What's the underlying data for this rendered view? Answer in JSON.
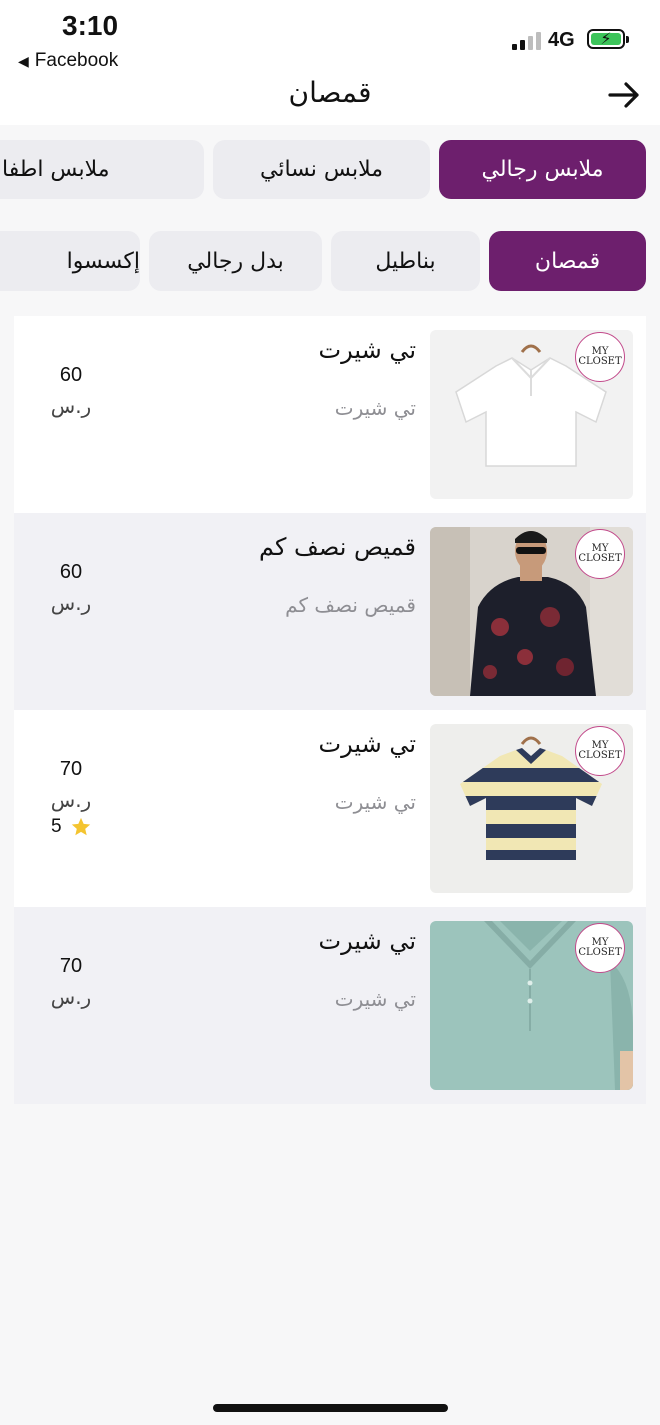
{
  "status": {
    "time": "3:10",
    "back_app": "Facebook",
    "network": "4G"
  },
  "header": {
    "title": "قمصان"
  },
  "category_tabs": [
    {
      "label": "ملابس رجالي",
      "active": true
    },
    {
      "label": "ملابس نسائي",
      "active": false
    },
    {
      "label": "ملابس اطفال",
      "active": false
    }
  ],
  "subcategory_tabs": [
    {
      "label": "قمصان",
      "active": true
    },
    {
      "label": "بناطيل",
      "active": false
    },
    {
      "label": "بدل رجالي",
      "active": false
    },
    {
      "label": "إكسسوا",
      "active": false
    }
  ],
  "brand": {
    "logo_text": [
      "MY",
      "CLOSET"
    ]
  },
  "products": [
    {
      "title": "تي شيرت",
      "subtitle": "تي شيرت",
      "price": "60",
      "currency": "ر.س",
      "rating": null,
      "image": "white-polo"
    },
    {
      "title": "قميص نصف كم",
      "subtitle": "قميص نصف كم",
      "price": "60",
      "currency": "ر.س",
      "rating": null,
      "image": "floral-shirt-model"
    },
    {
      "title": "تي شيرت",
      "subtitle": "تي شيرت",
      "price": "70",
      "currency": "ر.س",
      "rating": "5",
      "image": "striped-polo"
    },
    {
      "title": "تي شيرت",
      "subtitle": "تي شيرت",
      "price": "70",
      "currency": "ر.س",
      "rating": null,
      "image": "mint-polo"
    }
  ],
  "colors": {
    "accent": "#6d1f6d",
    "tab_bg": "#ececf0",
    "star": "#f4c430",
    "muted_text": "#8e8e93"
  }
}
